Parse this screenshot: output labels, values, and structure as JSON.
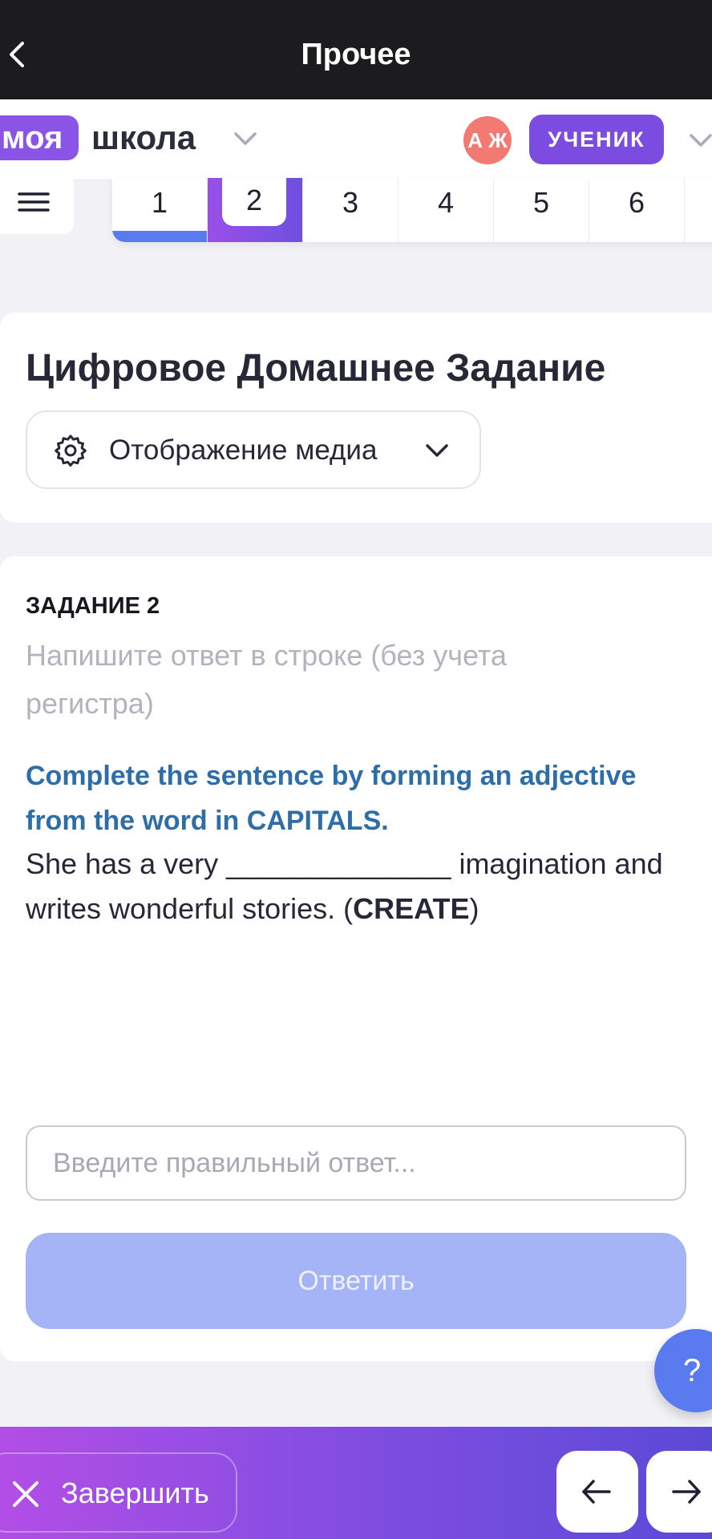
{
  "nav": {
    "title": "Прочее"
  },
  "school": {
    "logo_part1": "моя",
    "logo_part2": "школа",
    "avatar_initials": "А Ж",
    "role": "УЧЕНИК"
  },
  "tabs": [
    {
      "label": "1",
      "state": "done"
    },
    {
      "label": "2",
      "state": "active"
    },
    {
      "label": "3",
      "state": "default"
    },
    {
      "label": "4",
      "state": "default"
    },
    {
      "label": "5",
      "state": "default"
    },
    {
      "label": "6",
      "state": "default"
    }
  ],
  "header": {
    "title": "Цифровое Домашнее Задание",
    "media_label": "Отображение медиа"
  },
  "task": {
    "number_label": "ЗАДАНИЕ 2",
    "hint": "Напишите ответ в строке (без учета регистра)",
    "instruction": "Complete the sentence by forming an adjective from the word in CAPITALS.",
    "sentence_before": "She has a very ______________ imagination and writes wonderful stories. (",
    "sentence_keyword": "CREATE",
    "sentence_after": ")",
    "answer_value": "",
    "answer_placeholder": "Введите правильный ответ...",
    "submit_label": "Ответить"
  },
  "help": {
    "label": "?"
  },
  "footer": {
    "finish_label": "Завершить"
  },
  "colors": {
    "accent_purple": "#8a55e6",
    "accent_blue": "#5a7bf0",
    "submit_disabled": "#a4b4f6",
    "instruction_blue": "#2d6ea8"
  }
}
